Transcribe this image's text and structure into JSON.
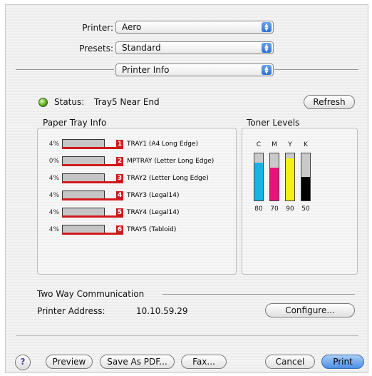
{
  "printer": {
    "label": "Printer:",
    "value": "Aero"
  },
  "presets": {
    "label": "Presets:",
    "value": "Standard"
  },
  "panel": {
    "value": "Printer Info"
  },
  "status": {
    "label": "Status:",
    "value": "Tray5 Near End",
    "led_color": "#5aa818"
  },
  "refresh_label": "Refresh",
  "paper_tray": {
    "title": "Paper Tray Info",
    "trays": [
      {
        "percent": "4%",
        "number": "1",
        "name": "TRAY1 (A4 Long Edge)"
      },
      {
        "percent": "0%",
        "number": "2",
        "name": "MPTRAY (Letter Long Edge)"
      },
      {
        "percent": "4%",
        "number": "3",
        "name": "TRAY2 (Letter Long Edge)"
      },
      {
        "percent": "4%",
        "number": "4",
        "name": "TRAY3 (Legal14)"
      },
      {
        "percent": "4%",
        "number": "5",
        "name": "TRAY4 (Legal14)"
      },
      {
        "percent": "4%",
        "number": "6",
        "name": "TRAY5 (Tabloid)"
      }
    ]
  },
  "toner": {
    "title": "Toner Levels",
    "items": [
      {
        "letter": "C",
        "value": "80",
        "level": 0.8,
        "color": "#1ab0e8"
      },
      {
        "letter": "M",
        "value": "70",
        "level": 0.7,
        "color": "#e8137a"
      },
      {
        "letter": "Y",
        "value": "90",
        "level": 0.9,
        "color": "#f6ef14"
      },
      {
        "letter": "K",
        "value": "50",
        "level": 0.5,
        "color": "#000000"
      }
    ]
  },
  "two_way": {
    "title": "Two Way Communication",
    "address_label": "Printer Address:",
    "address_value": "10.10.59.29",
    "configure_label": "Configure..."
  },
  "footer": {
    "help_label": "?",
    "preview_label": "Preview",
    "save_pdf_label": "Save As PDF...",
    "fax_label": "Fax...",
    "cancel_label": "Cancel",
    "print_label": "Print"
  }
}
